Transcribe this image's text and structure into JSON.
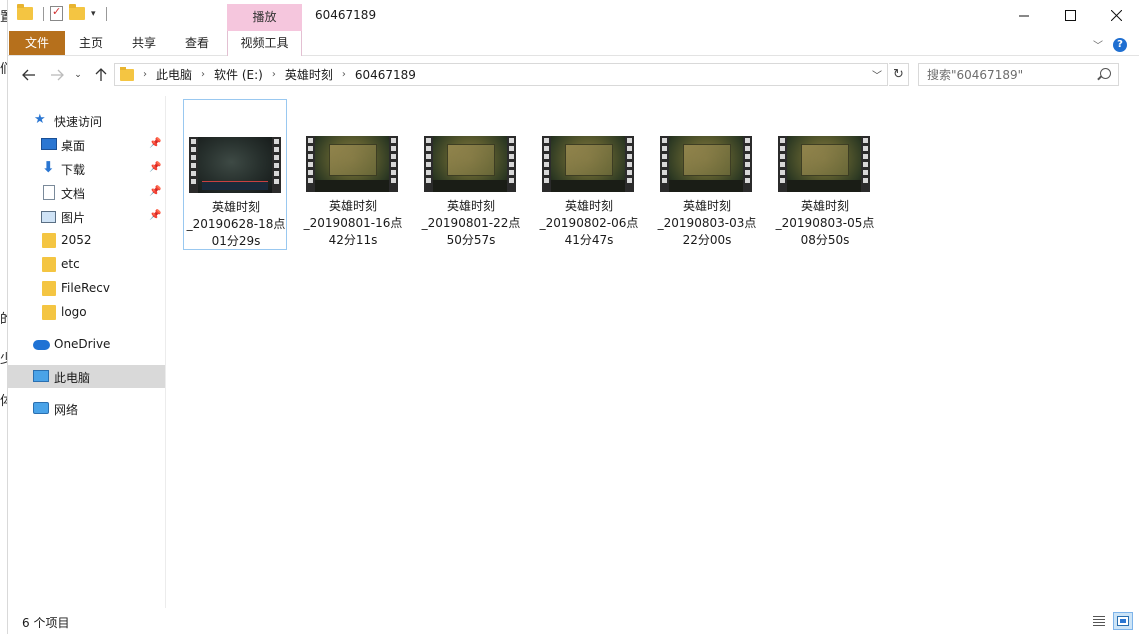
{
  "window": {
    "title": "60467189",
    "context_tab_header": "播放"
  },
  "ribbon": {
    "tabs": [
      "文件",
      "主页",
      "共享",
      "查看"
    ],
    "context_tab": "视频工具"
  },
  "address": {
    "crumbs": [
      "此电脑",
      "软件 (E:)",
      "英雄时刻",
      "60467189"
    ]
  },
  "search": {
    "placeholder": "搜索\"60467189\""
  },
  "nav": {
    "quick_access": "快速访问",
    "items": [
      {
        "label": "桌面",
        "icon": "desktop-icon",
        "pinned": true
      },
      {
        "label": "下载",
        "icon": "download-icon",
        "pinned": true
      },
      {
        "label": "文档",
        "icon": "document-icon",
        "pinned": true
      },
      {
        "label": "图片",
        "icon": "pictures-icon",
        "pinned": true
      },
      {
        "label": "2052",
        "icon": "folder-icon"
      },
      {
        "label": "etc",
        "icon": "folder-icon"
      },
      {
        "label": "FileRecv",
        "icon": "folder-icon"
      },
      {
        "label": "logo",
        "icon": "folder-icon"
      }
    ],
    "onedrive": "OneDrive",
    "this_pc": "此电脑",
    "network": "网络"
  },
  "files": [
    {
      "line1": "英雄时刻",
      "line2": "_20190628-18点",
      "line3": "01分29s",
      "thumb": "dark",
      "selected": true
    },
    {
      "line1": "英雄时刻",
      "line2": "_20190801-16点",
      "line3": "42分11s",
      "thumb": "board"
    },
    {
      "line1": "英雄时刻",
      "line2": "_20190801-22点",
      "line3": "50分57s",
      "thumb": "board"
    },
    {
      "line1": "英雄时刻",
      "line2": "_20190802-06点",
      "line3": "41分47s",
      "thumb": "board"
    },
    {
      "line1": "英雄时刻",
      "line2": "_20190803-03点",
      "line3": "22分00s",
      "thumb": "board"
    },
    {
      "line1": "英雄时刻",
      "line2": "_20190803-05点",
      "line3": "08分50s",
      "thumb": "board"
    }
  ],
  "status": {
    "item_count": "6 个项目"
  },
  "background_window_chars": [
    "置",
    "们",
    "的",
    "少",
    "体"
  ]
}
